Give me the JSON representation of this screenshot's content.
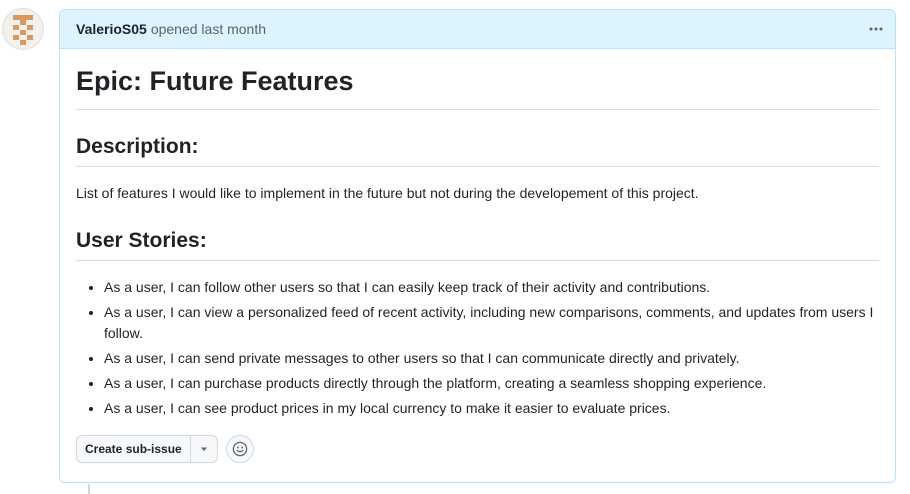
{
  "comment": {
    "author": "ValerioS05",
    "meta": "opened last month",
    "menu_icon": "kebab-horizontal-icon"
  },
  "issue": {
    "title": "Epic: Future Features",
    "description_heading": "Description:",
    "description": "List of features I would like to implement in the future but not during the developement of this project.",
    "stories_heading": "User Stories:",
    "stories": [
      "As a user, I can follow other users so that I can easily keep track of their activity and contributions.",
      "As a user, I can view a personalized feed of recent activity, including new comparisons, comments, and updates from users I follow.",
      "As a user, I can send private messages to other users so that I can communicate directly and privately.",
      "As a user, I can purchase products directly through the platform, creating a seamless shopping experience.",
      "As a user, I can see product prices in my local currency to make it easier to evaluate prices."
    ]
  },
  "actions": {
    "create_sub_issue": "Create sub-issue",
    "dropdown_icon": "triangle-down-icon",
    "reaction_icon": "smiley-icon"
  },
  "colors": {
    "header_bg": "#ddf4ff",
    "header_border": "#b6e3ff",
    "avatar_accent": "#d89a63"
  }
}
